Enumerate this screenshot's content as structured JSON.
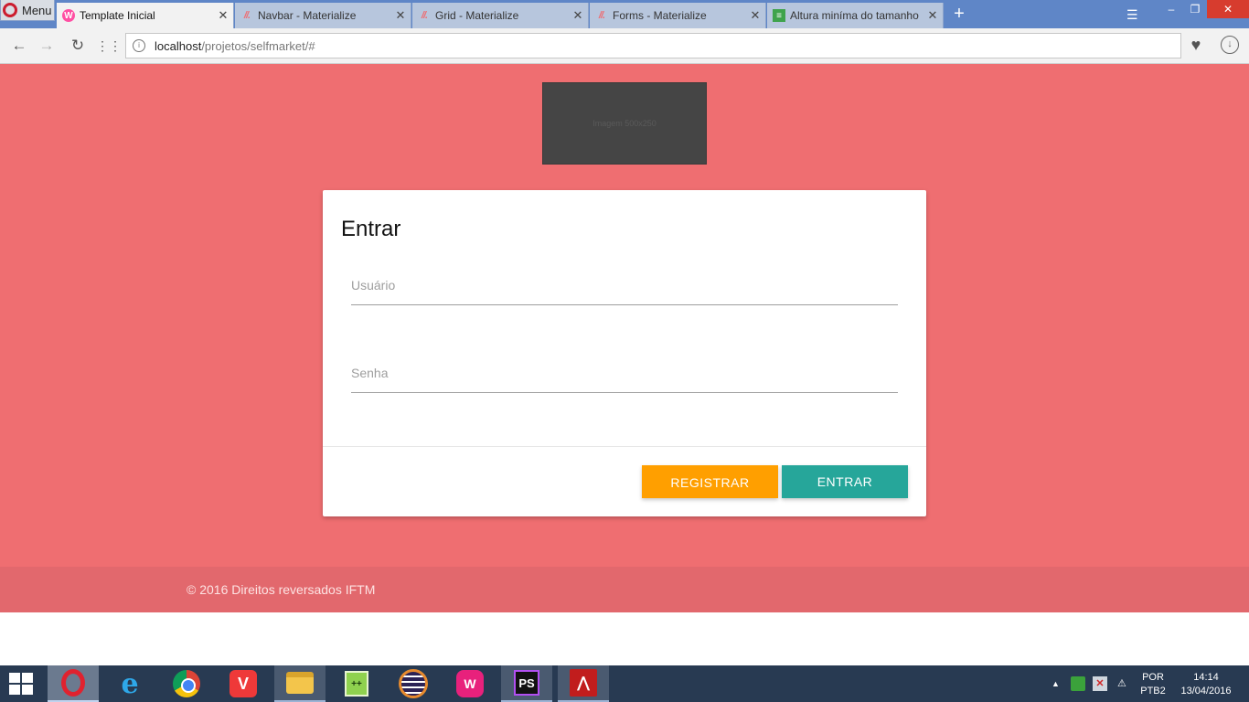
{
  "browser": {
    "menu_label": "Menu",
    "tabs": [
      {
        "title": "Template Inicial",
        "close": "✕",
        "favicon": "wamp-icon"
      },
      {
        "title": "Navbar - Materialize",
        "close": "✕",
        "favicon": "materialize-icon"
      },
      {
        "title": "Grid - Materialize",
        "close": "✕",
        "favicon": "materialize-icon"
      },
      {
        "title": "Forms - Materialize",
        "close": "✕",
        "favicon": "materialize-icon"
      },
      {
        "title": "Altura miníma do tamanho",
        "close": "✕",
        "favicon": "stackoverflow-icon"
      }
    ],
    "new_tab": "+",
    "address": {
      "host": "localhost",
      "path": "/projetos/selfmarket/#"
    }
  },
  "page": {
    "image_placeholder": "Imagem 500x250",
    "login": {
      "title": "Entrar",
      "username_label": "Usuário",
      "password_label": "Senha",
      "register_button": "REGISTRAR",
      "submit_button": "ENTRAR"
    },
    "footer": "© 2016 Direitos reversados IFTM"
  },
  "taskbar": {
    "apps": [
      "opera",
      "internet-explorer",
      "chrome",
      "vivaldi",
      "file-explorer",
      "notepad-plus-plus",
      "eclipse",
      "wampserver",
      "phpstorm",
      "acrobat-reader"
    ],
    "language": {
      "line1": "POR",
      "line2": "PTB2"
    },
    "clock": {
      "time": "14:14",
      "date": "13/04/2016"
    }
  },
  "colors": {
    "page_background": "#ef6e71",
    "footer_background": "#e2686d",
    "register_button": "#ff9f00",
    "submit_button": "#26a69a"
  }
}
